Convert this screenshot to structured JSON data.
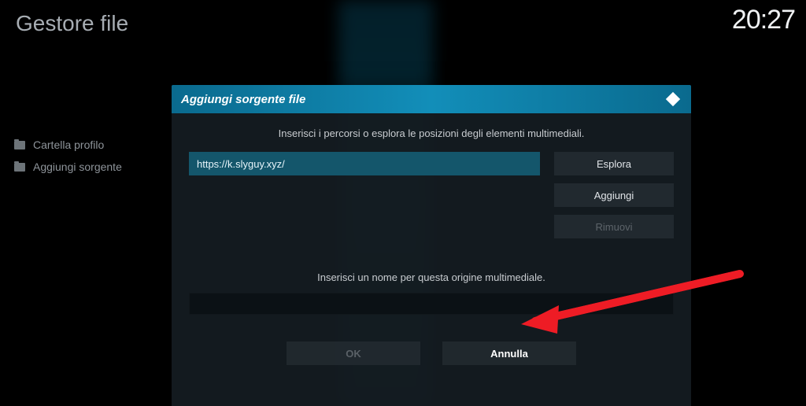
{
  "page": {
    "title": "Gestore file",
    "clock": "20:27"
  },
  "sidebar": {
    "items": [
      {
        "label": "Cartella profilo"
      },
      {
        "label": "Aggiungi sorgente"
      }
    ]
  },
  "dialog": {
    "title": "Aggiungi sorgente file",
    "instruction_paths": "Inserisci i percorsi o esplora le posizioni degli elementi multimediali.",
    "path_value": "https://k.slyguy.xyz/",
    "browse_label": "Esplora",
    "add_label": "Aggiungi",
    "remove_label": "Rimuovi",
    "instruction_name": "Inserisci un nome per questa origine multimediale.",
    "name_value": "",
    "ok_label": "OK",
    "cancel_label": "Annulla"
  },
  "colors": {
    "accent": "#128eb9",
    "arrow": "#ee1c25"
  }
}
